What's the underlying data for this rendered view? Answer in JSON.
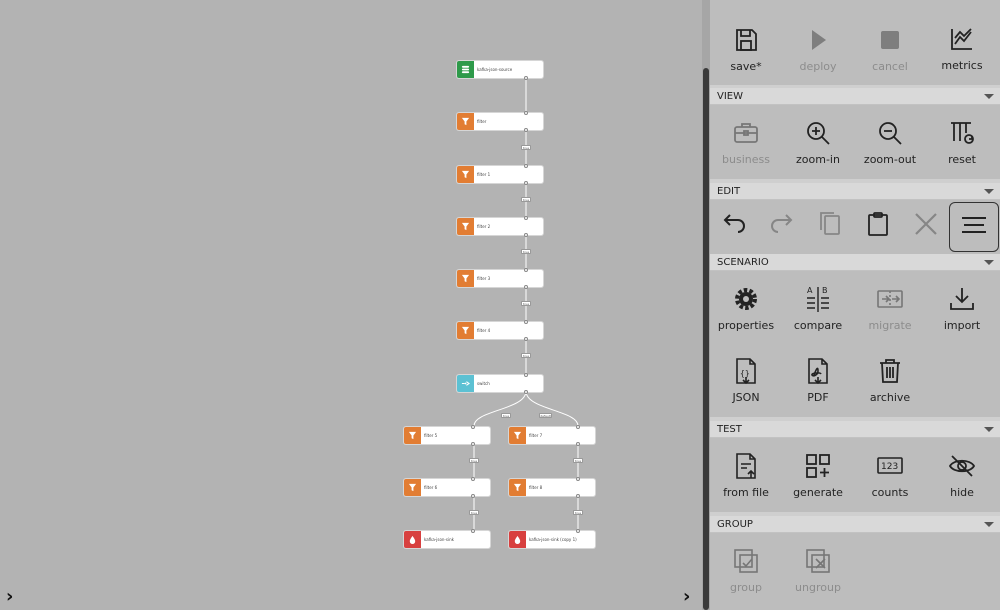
{
  "canvas": {
    "nodes": [
      {
        "id": "n0",
        "label": "kafka-json-source",
        "type": "source",
        "color": "#2e9a4a"
      },
      {
        "id": "n1",
        "label": "filter",
        "type": "filter",
        "color": "#e27d33"
      },
      {
        "id": "n2",
        "label": "filter 1",
        "type": "filter",
        "color": "#e27d33"
      },
      {
        "id": "n3",
        "label": "filter 2",
        "type": "filter",
        "color": "#e27d33"
      },
      {
        "id": "n4",
        "label": "filter 3",
        "type": "filter",
        "color": "#e27d33"
      },
      {
        "id": "n5",
        "label": "filter 4",
        "type": "filter",
        "color": "#e27d33"
      },
      {
        "id": "n6",
        "label": "switch",
        "type": "switch",
        "color": "#5cc1d3"
      },
      {
        "id": "n7",
        "label": "filter 5",
        "type": "filter",
        "color": "#e27d33"
      },
      {
        "id": "n8",
        "label": "filter 7",
        "type": "filter",
        "color": "#e27d33"
      },
      {
        "id": "n9",
        "label": "filter 6",
        "type": "filter",
        "color": "#e27d33"
      },
      {
        "id": "n10",
        "label": "filter 8",
        "type": "filter",
        "color": "#e27d33"
      },
      {
        "id": "n11",
        "label": "kafka-json-sink",
        "type": "sink",
        "color": "#d8403f"
      },
      {
        "id": "n12",
        "label": "kafka-json-sink (copy 1)",
        "type": "sink",
        "color": "#d8403f"
      }
    ],
    "edge_labels": {
      "true": "true",
      "default": "default"
    }
  },
  "toolbox": {
    "top": {
      "save": "save*",
      "deploy": "deploy",
      "cancel": "cancel",
      "metrics": "metrics"
    },
    "view": {
      "title": "VIEW",
      "business": "business",
      "zoom_in": "zoom-in",
      "zoom_out": "zoom-out",
      "reset": "reset"
    },
    "edit": {
      "title": "EDIT"
    },
    "scenario": {
      "title": "SCENARIO",
      "properties": "properties",
      "compare": "compare",
      "migrate": "migrate",
      "import": "import",
      "json": "JSON",
      "pdf": "PDF",
      "archive": "archive"
    },
    "test": {
      "title": "TEST",
      "from_file": "from file",
      "generate": "generate",
      "counts": "counts",
      "hide": "hide"
    },
    "group": {
      "title": "GROUP",
      "group": "group",
      "ungroup": "ungroup"
    }
  }
}
